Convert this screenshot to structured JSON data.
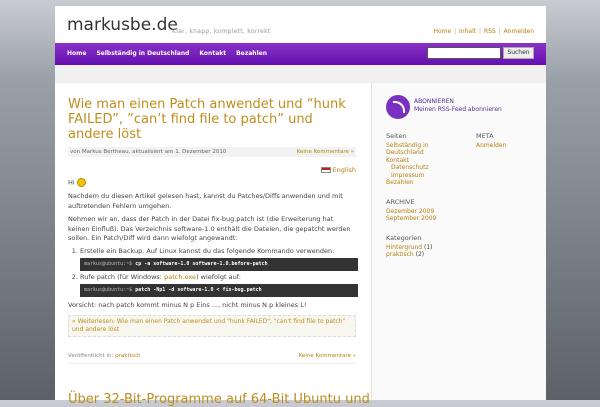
{
  "header": {
    "brand": "markusbe.de",
    "tagline": "Klar, knapp, komplett, korrekt",
    "links": [
      "Home",
      "Inhalt",
      "RSS",
      "Anmelden"
    ]
  },
  "nav": {
    "items": [
      "Home",
      "Selbständig in Deutschland",
      "Kontakt",
      "Bezahlen"
    ],
    "search_button": "Suchen",
    "search_value": ""
  },
  "post": {
    "title": "Wie man einen Patch anwendet und “hunk FAILED”, ”can’t find file to patch” und andere löst",
    "byline": "von Markus Bertheau, aktualisiert am 1. Dezember 2010",
    "comments": "Keine Kommentare »",
    "language": "English",
    "greeting": "Hi",
    "p1": "Nachdem du diesen Artikel gelesen hast, kannst du Patches/Diffs anwenden und mit auftretenden Fehlern umgehen.",
    "p2": "Nehmen wir an, dass der Patch in der Datei fix-bug.patch ist (die Erweiterung hat keinen Einfluß). Das Verzeichnis software-1.0 enthält die Dateien, die gepatcht werden sollen. Ein Patch/Diff wird dann wiefolgt angewandt:",
    "step1": "Erstelle ein Backup. Auf Linux kannst du das folgende Kommando verwenden:",
    "code1_prompt": "markus@ubuntu:~$",
    "code1_cmd": "cp -a software-1.0 software-1.0.before-patch",
    "step2_a": "Rufe patch (für Windows:",
    "step2_link": "patch.exe",
    "step2_b": ") wiefolgt auf:",
    "code2_prompt": "markus@ubuntu:~$",
    "code2_cmd": "patch -Np1 -d software-1.0 < fix-bug.patch",
    "caution": "Vorsicht: nach patch kommt minus N p Eins ..., nicht minus N p kleines L!",
    "readmore": "» Weiterlesen: Wie man einen Patch anwendet und \"hunk FAILED\", \"can't find file to patch\" und andere löst",
    "published_label": "Veröffentlicht in:",
    "category": "praktisch",
    "comments_bottom": "Keine Kommentare »",
    "next_title": "Über 32-Bit-Programme auf 64-Bit Ubuntu und"
  },
  "sidebar": {
    "rss_title": "ABONNIEREN",
    "rss_link": "Meinen RSS-Feed abonnieren",
    "pages_heading": "Seiten",
    "pages": [
      "Selbständig in Deutschland",
      "Kontakt",
      "Datenschutz",
      "Impressum",
      "Bezahlen"
    ],
    "meta_heading": "META",
    "meta_items": [
      "Anmelden"
    ],
    "archive_heading": "ARCHIVE",
    "archive": [
      "Dezember 2009",
      "September 2009"
    ],
    "cats_heading": "Kategorien",
    "cats": [
      {
        "name": "Hintergrund",
        "count": "(1)"
      },
      {
        "name": "praktisch",
        "count": "(2)"
      }
    ]
  },
  "colors": {
    "nav": "#7a24c0",
    "accent": "#c08d1c"
  }
}
